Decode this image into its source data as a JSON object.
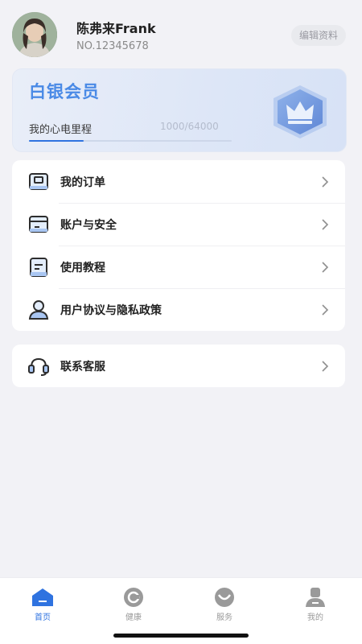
{
  "profile": {
    "name": "陈弗来Frank",
    "number": "NO.12345678",
    "edit_label": "编辑资料"
  },
  "member": {
    "level": "白银会员",
    "journey_label": "我的心电里程",
    "progress_text": "1000/64000",
    "progress_fraction": 0.27,
    "accent": "#4A8AE6"
  },
  "menu_primary": [
    {
      "label": "我的订单",
      "icon": "order-icon"
    },
    {
      "label": "账户与安全",
      "icon": "wallet-icon"
    },
    {
      "label": "使用教程",
      "icon": "tutorial-icon"
    },
    {
      "label": "用户协议与隐私政策",
      "icon": "user-agreement-icon"
    }
  ],
  "menu_secondary": [
    {
      "label": "联系客服",
      "icon": "headset-icon"
    }
  ],
  "tabbar": {
    "tabs": [
      {
        "label": "首页",
        "icon": "home-icon",
        "active": true
      },
      {
        "label": "健康",
        "icon": "health-icon",
        "active": false
      },
      {
        "label": "服务",
        "icon": "service-icon",
        "active": false
      },
      {
        "label": "我的",
        "icon": "profile-icon",
        "active": false
      }
    ],
    "active_color": "#2F73E0"
  }
}
